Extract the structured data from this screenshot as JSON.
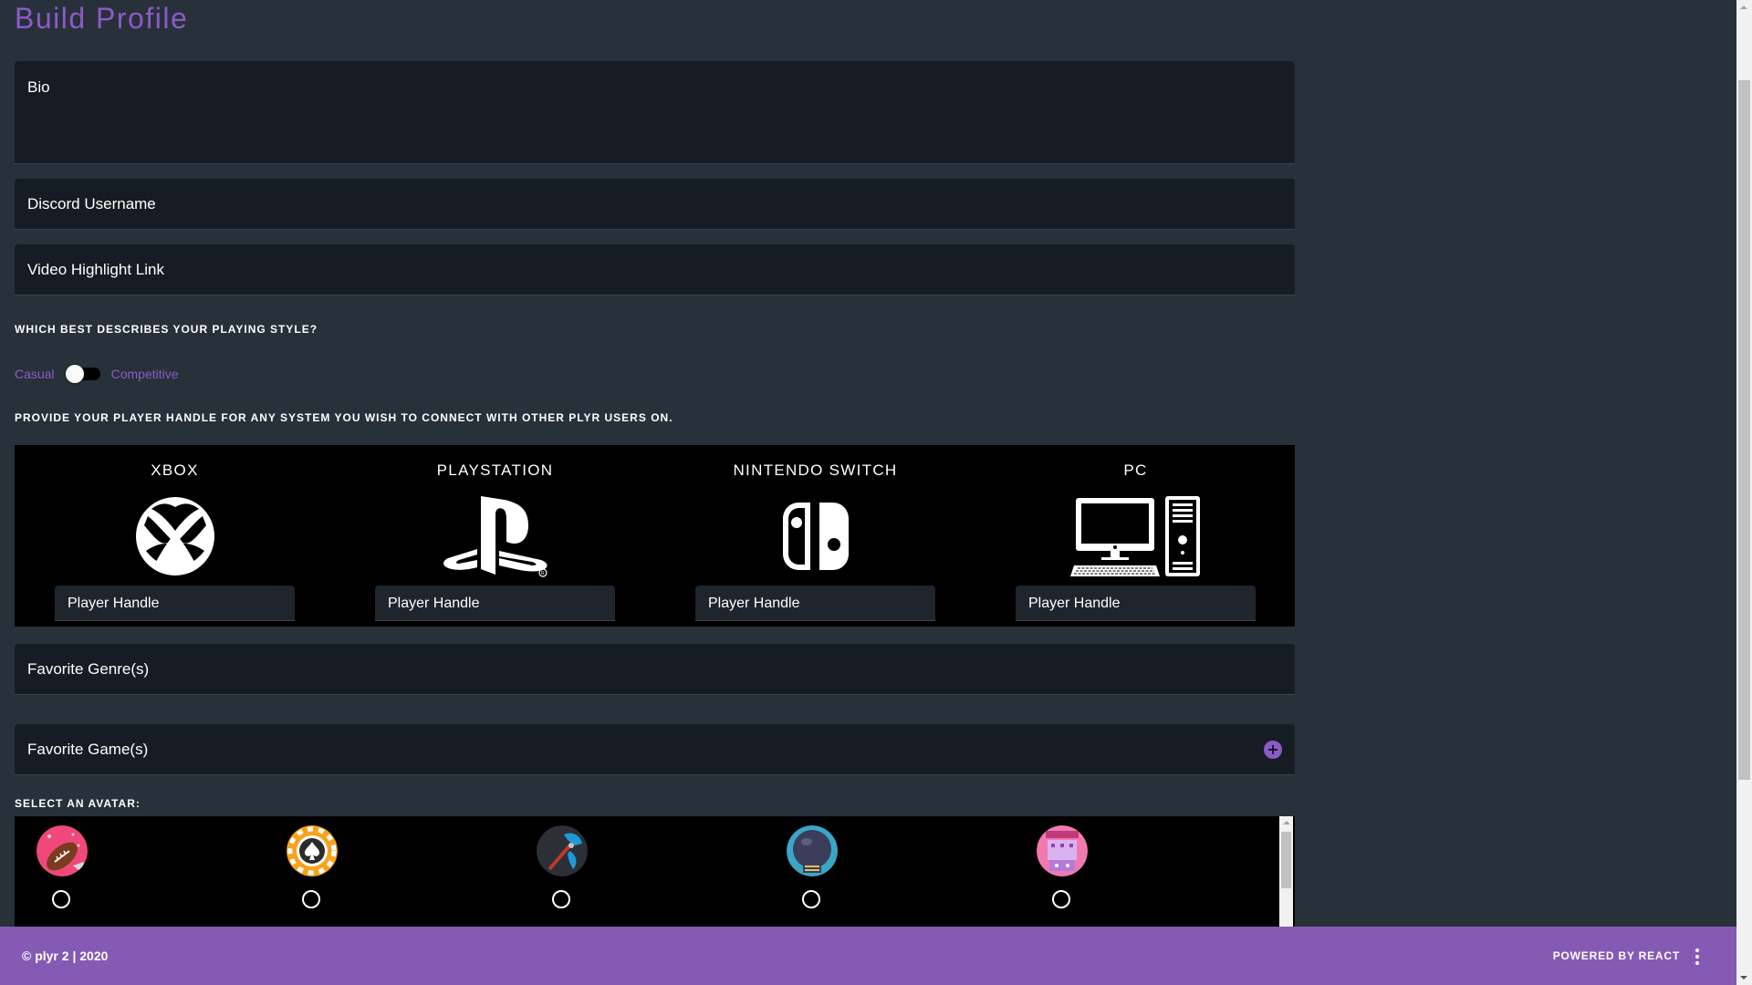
{
  "page": {
    "title": "Build Profile"
  },
  "form": {
    "bio_label": "Bio",
    "discord_label": "Discord Username",
    "video_label": "Video Highlight Link",
    "style_question": "WHICH BEST DESCRIBES YOUR PLAYING STYLE?",
    "style_left": "Casual",
    "style_right": "Competitive",
    "style_toggle_on": false,
    "handles_question": "PROVIDE YOUR PLAYER HANDLE FOR ANY SYSTEM YOU WISH TO CONNECT WITH OTHER PLYR USERS ON.",
    "genres_label": "Favorite Genre(s)",
    "games_label": "Favorite Game(s)",
    "avatar_question": "SELECT AN AVATAR:"
  },
  "platforms": [
    {
      "name": "XBOX",
      "icon": "xbox-logo-icon",
      "handle_label": "Player Handle"
    },
    {
      "name": "PLAYSTATION",
      "icon": "playstation-logo-icon",
      "handle_label": "Player Handle"
    },
    {
      "name": "NINTENDO SWITCH",
      "icon": "nintendo-switch-logo-icon",
      "handle_label": "Player Handle"
    },
    {
      "name": "PC",
      "icon": "pc-computer-icon",
      "handle_label": "Player Handle"
    }
  ],
  "avatars": [
    {
      "icon": "football-avatar-icon",
      "selected": false
    },
    {
      "icon": "poker-chip-avatar-icon",
      "selected": false
    },
    {
      "icon": "battle-axe-avatar-icon",
      "selected": false
    },
    {
      "icon": "boxing-glove-avatar-icon",
      "selected": false
    },
    {
      "icon": "arcade-avatar-icon",
      "selected": false
    }
  ],
  "footer": {
    "copyright": "© plyr 2 | 2020",
    "powered": "POWERED BY REACT"
  },
  "colors": {
    "accent": "#8c5ac8",
    "footer": "#855ab4",
    "background": "#28313a",
    "field": "#161c23",
    "panel": "#000000"
  }
}
